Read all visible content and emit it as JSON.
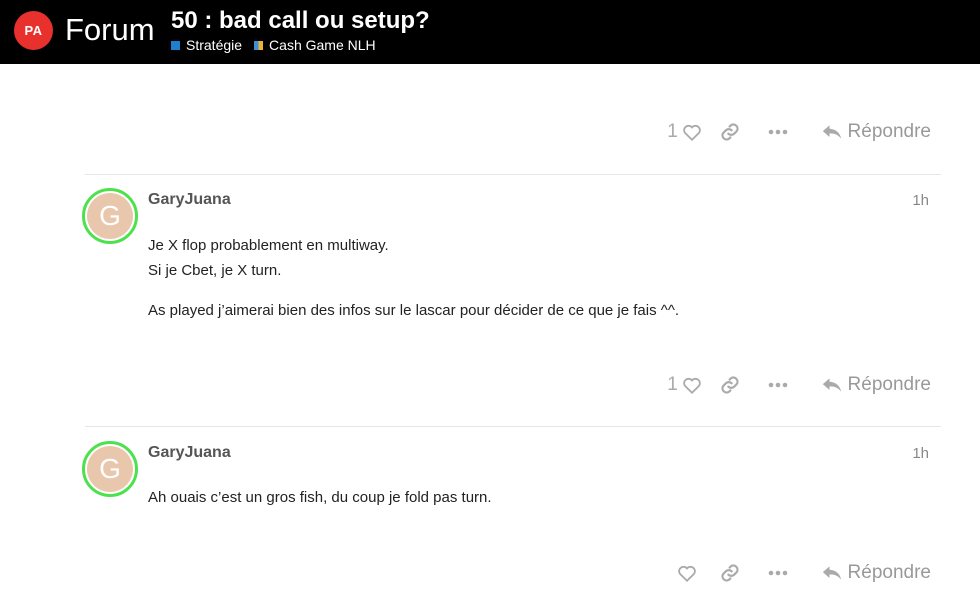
{
  "header": {
    "logo_badge": "PA",
    "logo_text": "Forum",
    "topic_title": "50 : bad call ou setup?",
    "categories": [
      {
        "label": "Stratégie",
        "color": "#1e7fd0"
      },
      {
        "label": "Cash Game NLH",
        "color": "#3d8fd4"
      }
    ]
  },
  "posts": [
    {
      "actions": {
        "like_count": "1",
        "reply_label": "Répondre"
      }
    },
    {
      "author": "GaryJuana",
      "avatar_letter": "G",
      "time": "1h",
      "lines_p1": [
        "Je X flop probablement en multiway.",
        "Si je Cbet, je X turn."
      ],
      "paragraph2": "As played j’aimerai bien des infos sur le lascar pour décider de ce que je fais ^^.",
      "actions": {
        "like_count": "1",
        "reply_label": "Répondre"
      }
    },
    {
      "author": "GaryJuana",
      "avatar_letter": "G",
      "time": "1h",
      "paragraph1": "Ah ouais c’est un gros fish, du coup je fold pas turn.",
      "actions": {
        "like_count": "",
        "reply_label": "Répondre"
      }
    }
  ],
  "colors": {
    "header_bg": "#000000",
    "logo_red": "#e8312c",
    "avatar_ring": "#4de14d",
    "avatar_bg": "#e8c7ad"
  }
}
